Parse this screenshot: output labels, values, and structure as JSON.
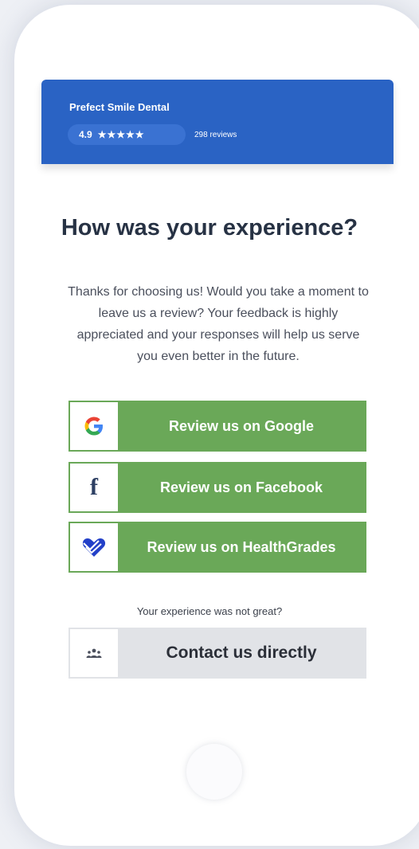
{
  "business": {
    "name": "Prefect Smile Dental",
    "rating": "4.9",
    "stars": "★★★★★",
    "reviews": "298 reviews"
  },
  "main": {
    "title": "How was your experience?",
    "description": "Thanks for choosing us! Would you take a moment to leave us a review? Your feedback is highly appreciated and your responses will help us serve you even better in the future."
  },
  "buttons": {
    "google": "Review us on Google",
    "facebook": "Review us on Facebook",
    "healthgrades": "Review us on HealthGrades"
  },
  "feedback": {
    "note": "Your experience was not great?",
    "contact": "Contact us directly"
  },
  "colors": {
    "header": "#2a63c4",
    "button_green": "#6aa858",
    "contact_gray": "#e1e3e7"
  },
  "icons": {
    "google": "google-icon",
    "facebook": "facebook-icon",
    "healthgrades": "healthgrades-heart-icon",
    "contact": "people-group-icon"
  }
}
